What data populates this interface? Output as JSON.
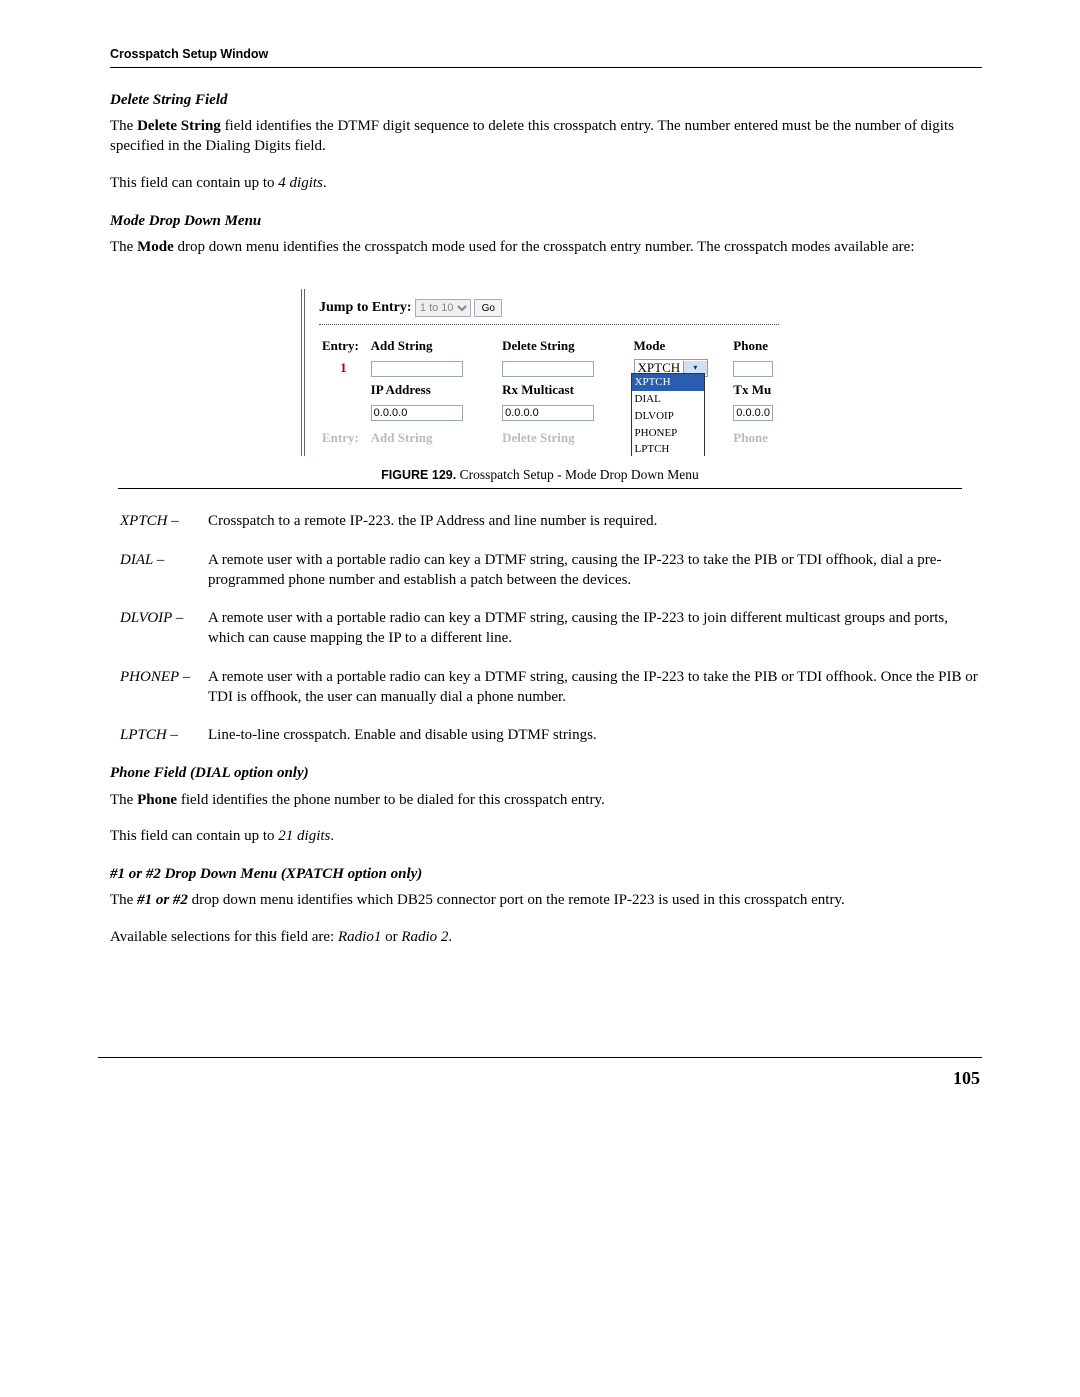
{
  "header": {
    "title": "Crosspatch Setup Window"
  },
  "sections": {
    "deleteStr": {
      "heading": "Delete String Field",
      "p1a": "The ",
      "p1b": "Delete String",
      "p1c": " field identifies the DTMF digit sequence to delete this crosspatch entry. The number entered must be the number of digits specified in the Dialing Digits field.",
      "p2a": "This field can contain up to ",
      "p2b": "4 digits",
      "p2c": "."
    },
    "modeMenu": {
      "heading": "Mode Drop Down Menu",
      "p1a": "The ",
      "p1b": "Mode",
      "p1c": " drop down menu identifies the crosspatch mode used for the crosspatch entry number. The crosspatch modes available are:"
    },
    "phoneField": {
      "heading": "Phone Field (DIAL option only)",
      "p1a": "The ",
      "p1b": "Phone",
      "p1c": " field identifies the phone number to be dialed for this crosspatch entry.",
      "p2a": "This field can contain up to ",
      "p2b": "21 digits",
      "p2c": "."
    },
    "oneTwoMenu": {
      "heading": "#1 or #2 Drop Down Menu (XPATCH option only)",
      "p1a": "The ",
      "p1b": "#1 or #2",
      "p1c": " drop down menu identifies which DB25 connector port on the remote IP-223 is used in this crosspatch entry.",
      "p2a": "Available selections for this field are: ",
      "p2b": "Radio1",
      "p2c": " or ",
      "p2d": "Radio 2",
      "p2e": "."
    }
  },
  "figure": {
    "jumpLabel": "Jump to Entry:",
    "jumpRange": "1 to 10",
    "goLabel": "Go",
    "headers": {
      "entry": "Entry:",
      "add": "Add String",
      "del": "Delete String",
      "mode": "Mode",
      "phone": "Phone"
    },
    "row1": {
      "entryNum": "1",
      "modeSelected": "XPTCH"
    },
    "dropdownOptions": [
      "XPTCH",
      "DIAL",
      "DLVOIP",
      "PHONEP",
      "LPTCH"
    ],
    "subHeaders": {
      "ip": "IP Address",
      "rx": "Rx Multicast",
      "tx": "Tx Mu"
    },
    "subValues": {
      "ip": "0.0.0.0",
      "rx": "0.0.0.0",
      "tx": "0.0.0.0"
    },
    "captionLabel": "FIGURE 129.",
    "captionText": " Crosspatch Setup - Mode Drop Down Menu"
  },
  "definitions": [
    {
      "term": "XPTCH –",
      "desc": "Crosspatch to a remote IP-223. the IP Address and line number is required."
    },
    {
      "term": "DIAL –",
      "desc": "A remote user with a portable radio can key a DTMF string, causing the IP-223 to take the PIB or TDI offhook, dial a pre-programmed phone number and establish a patch between the devices."
    },
    {
      "term": "DLVOIP –",
      "desc": "A remote user with a portable radio can key a DTMF string, causing the IP-223 to join different multicast groups and ports, which can cause mapping the IP to a different line."
    },
    {
      "term": "PHONEP –",
      "desc": "A remote user with a portable radio can key a DTMF string, causing the IP-223 to take the PIB or TDI offhook. Once the PIB or TDI is offhook, the user can manually dial a phone number."
    },
    {
      "term": "LPTCH –",
      "desc": "Line-to-line crosspatch. Enable and disable using DTMF strings."
    }
  ],
  "pageNumber": "105"
}
